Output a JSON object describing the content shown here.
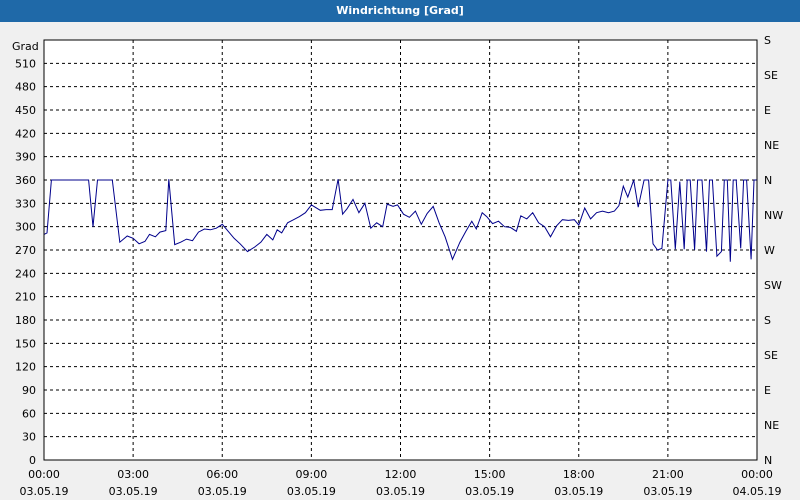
{
  "window": {
    "title": "Windrichtung [Grad]"
  },
  "chart_data": {
    "type": "line",
    "title": "Windrichtung [Grad]",
    "ylabel": "Grad",
    "ylim": [
      0,
      540
    ],
    "y_ticks": [
      0,
      30,
      60,
      90,
      120,
      150,
      180,
      210,
      240,
      270,
      300,
      330,
      360,
      390,
      420,
      450,
      480,
      510
    ],
    "right_axis": {
      "labels": [
        "N",
        "NE",
        "E",
        "SE",
        "S",
        "SW",
        "W",
        "NW",
        "N",
        "NE",
        "E",
        "SE",
        "S"
      ],
      "values": [
        0,
        45,
        90,
        135,
        180,
        225,
        270,
        315,
        360,
        405,
        450,
        495,
        540
      ]
    },
    "x_ticks": [
      {
        "time": "00:00",
        "date": "03.05.19",
        "hour": 0
      },
      {
        "time": "03:00",
        "date": "03.05.19",
        "hour": 3
      },
      {
        "time": "06:00",
        "date": "03.05.19",
        "hour": 6
      },
      {
        "time": "09:00",
        "date": "03.05.19",
        "hour": 9
      },
      {
        "time": "12:00",
        "date": "03.05.19",
        "hour": 12
      },
      {
        "time": "15:00",
        "date": "03.05.19",
        "hour": 15
      },
      {
        "time": "18:00",
        "date": "03.05.19",
        "hour": 18
      },
      {
        "time": "21:00",
        "date": "03.05.19",
        "hour": 21
      },
      {
        "time": "00:00",
        "date": "04.05.19",
        "hour": 24
      }
    ],
    "xlim_hours": [
      0,
      24
    ],
    "grid": true,
    "line_color": "#00008b",
    "series": [
      {
        "values": [
          [
            0.0,
            290
          ],
          [
            0.1,
            292
          ],
          [
            0.25,
            360
          ],
          [
            0.5,
            360
          ],
          [
            0.8,
            360
          ],
          [
            1.0,
            360
          ],
          [
            1.2,
            360
          ],
          [
            1.4,
            360
          ],
          [
            1.5,
            360
          ],
          [
            1.65,
            300
          ],
          [
            1.8,
            360
          ],
          [
            2.0,
            360
          ],
          [
            2.3,
            360
          ],
          [
            2.55,
            280
          ],
          [
            2.8,
            288
          ],
          [
            3.0,
            285
          ],
          [
            3.2,
            278
          ],
          [
            3.4,
            281
          ],
          [
            3.55,
            290
          ],
          [
            3.75,
            287
          ],
          [
            3.9,
            293
          ],
          [
            4.1,
            295
          ],
          [
            4.2,
            361
          ],
          [
            4.4,
            277
          ],
          [
            4.6,
            280
          ],
          [
            4.8,
            284
          ],
          [
            5.0,
            282
          ],
          [
            5.2,
            293
          ],
          [
            5.4,
            297
          ],
          [
            5.6,
            296
          ],
          [
            5.8,
            298
          ],
          [
            6.0,
            303
          ],
          [
            6.2,
            294
          ],
          [
            6.4,
            285
          ],
          [
            6.6,
            278
          ],
          [
            6.85,
            268
          ],
          [
            7.1,
            274
          ],
          [
            7.3,
            280
          ],
          [
            7.5,
            290
          ],
          [
            7.7,
            283
          ],
          [
            7.85,
            296
          ],
          [
            8.0,
            292
          ],
          [
            8.2,
            305
          ],
          [
            8.4,
            309
          ],
          [
            8.6,
            313
          ],
          [
            8.8,
            318
          ],
          [
            9.0,
            328
          ],
          [
            9.3,
            321
          ],
          [
            9.5,
            322
          ],
          [
            9.7,
            322
          ],
          [
            9.9,
            361
          ],
          [
            10.05,
            316
          ],
          [
            10.2,
            323
          ],
          [
            10.4,
            335
          ],
          [
            10.6,
            318
          ],
          [
            10.8,
            330
          ],
          [
            11.0,
            298
          ],
          [
            11.2,
            305
          ],
          [
            11.4,
            300
          ],
          [
            11.55,
            329
          ],
          [
            11.75,
            326
          ],
          [
            11.9,
            328
          ],
          [
            12.1,
            316
          ],
          [
            12.3,
            312
          ],
          [
            12.5,
            320
          ],
          [
            12.7,
            303
          ],
          [
            12.9,
            317
          ],
          [
            13.1,
            326
          ],
          [
            13.3,
            305
          ],
          [
            13.5,
            287
          ],
          [
            13.75,
            258
          ],
          [
            14.0,
            280
          ],
          [
            14.2,
            294
          ],
          [
            14.4,
            307
          ],
          [
            14.55,
            297
          ],
          [
            14.75,
            318
          ],
          [
            14.9,
            313
          ],
          [
            15.1,
            304
          ],
          [
            15.3,
            307
          ],
          [
            15.5,
            300
          ],
          [
            15.7,
            299
          ],
          [
            15.9,
            294
          ],
          [
            16.05,
            314
          ],
          [
            16.25,
            310
          ],
          [
            16.45,
            318
          ],
          [
            16.65,
            305
          ],
          [
            16.85,
            300
          ],
          [
            17.05,
            287
          ],
          [
            17.25,
            301
          ],
          [
            17.45,
            309
          ],
          [
            17.65,
            308
          ],
          [
            17.85,
            309
          ],
          [
            18.0,
            302
          ],
          [
            18.2,
            324
          ],
          [
            18.4,
            310
          ],
          [
            18.6,
            318
          ],
          [
            18.8,
            320
          ],
          [
            19.0,
            318
          ],
          [
            19.2,
            320
          ],
          [
            19.35,
            327
          ],
          [
            19.5,
            352
          ],
          [
            19.65,
            338
          ],
          [
            19.85,
            360
          ],
          [
            20.0,
            325
          ],
          [
            20.2,
            360
          ],
          [
            20.35,
            360
          ],
          [
            20.5,
            278
          ],
          [
            20.65,
            270
          ],
          [
            20.8,
            272
          ],
          [
            21.0,
            360
          ],
          [
            21.1,
            360
          ],
          [
            21.25,
            271
          ],
          [
            21.4,
            358
          ],
          [
            21.55,
            271
          ],
          [
            21.65,
            360
          ],
          [
            21.75,
            360
          ],
          [
            21.9,
            270
          ],
          [
            22.0,
            360
          ],
          [
            22.15,
            360
          ],
          [
            22.3,
            268
          ],
          [
            22.4,
            360
          ],
          [
            22.5,
            360
          ],
          [
            22.65,
            262
          ],
          [
            22.8,
            268
          ],
          [
            22.9,
            360
          ],
          [
            23.0,
            360
          ],
          [
            23.1,
            255
          ],
          [
            23.2,
            360
          ],
          [
            23.3,
            360
          ],
          [
            23.45,
            272
          ],
          [
            23.55,
            360
          ],
          [
            23.65,
            360
          ],
          [
            23.8,
            258
          ],
          [
            23.9,
            360
          ],
          [
            24.0,
            360
          ]
        ]
      }
    ]
  }
}
